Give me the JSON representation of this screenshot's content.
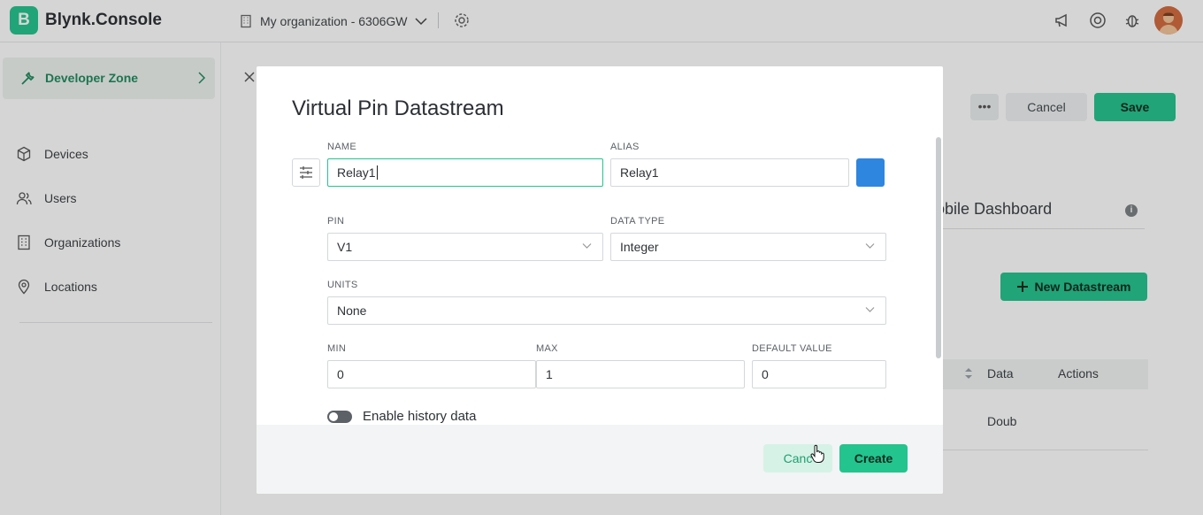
{
  "header": {
    "logo_letter": "B",
    "app_name": "Blynk.Console",
    "org_name": "My organization - 6306GW",
    "icons": [
      "building-icon",
      "chevron-down-icon",
      "gear-icon",
      "megaphone-icon",
      "help-circle-icon",
      "bug-icon",
      "avatar"
    ]
  },
  "sidebar": {
    "developer_zone": "Developer Zone",
    "items": [
      {
        "label": "Devices",
        "icon": "cube-icon"
      },
      {
        "label": "Users",
        "icon": "users-icon"
      },
      {
        "label": "Organizations",
        "icon": "building-icon"
      },
      {
        "label": "Locations",
        "icon": "location-pin-icon"
      }
    ]
  },
  "page": {
    "more_label": "•••",
    "cancel_label": "Cancel",
    "save_label": "Save",
    "mobile_tab": "obile Dashboard",
    "info_glyph": "i",
    "new_datastream_label": "New Datastream",
    "table": {
      "col_data": "Data",
      "col_actions": "Actions",
      "row_data": "Doub"
    }
  },
  "modal": {
    "title": "Virtual Pin Datastream",
    "name_label": "NAME",
    "name_value": "Relay1",
    "alias_label": "ALIAS",
    "alias_value": "Relay1",
    "color": "#2e86de",
    "pin_label": "PIN",
    "pin_value": "V1",
    "data_type_label": "DATA TYPE",
    "data_type_value": "Integer",
    "units_label": "UNITS",
    "units_value": "None",
    "min_label": "MIN",
    "min_value": "0",
    "max_label": "MAX",
    "max_value": "1",
    "default_label": "DEFAULT VALUE",
    "default_value": "0",
    "history_label": "Enable history data",
    "history_enabled": false,
    "cancel_label": "Canc",
    "create_label": "Create"
  },
  "colors": {
    "accent": "#23c48e",
    "accent_text": "#1e8a5e"
  }
}
